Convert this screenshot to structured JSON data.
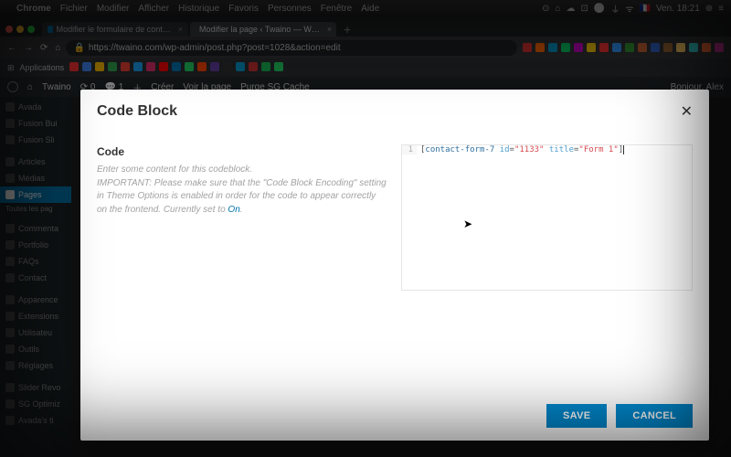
{
  "mac_menu": {
    "app": "Chrome",
    "items": [
      "Fichier",
      "Modifier",
      "Afficher",
      "Historique",
      "Favoris",
      "Personnes",
      "Fenêtre",
      "Aide"
    ],
    "clock": "Ven. 18:21"
  },
  "browser": {
    "tabs": [
      {
        "label": "Modifier le formulaire de cont…"
      },
      {
        "label": "Modifier la page ‹ Twaino — W…"
      }
    ],
    "active_tab": 1,
    "url_lock": "🔒",
    "url": "https://twaino.com/wp-admin/post.php?post=1028&action=edit",
    "bookmarks_label": "Applications",
    "ext_colors": [
      "#d33",
      "#f60",
      "#09c",
      "#0c6",
      "#c0c",
      "#fc0",
      "#f33",
      "#39f",
      "#393",
      "#c63",
      "#36c",
      "#963",
      "#fc6",
      "#3cc",
      "#e63",
      "#c39"
    ]
  },
  "wp": {
    "site": "Twaino",
    "comments_count": "1",
    "updates_count": "0",
    "create": "Créer",
    "view_page": "Voir la page",
    "purge": "Purge SG Cache",
    "greeting": "Bonjour, Alex",
    "sidebar": [
      "Avada",
      "Fusion Bui",
      "Fusion Sli",
      "",
      "Articles",
      "Médias",
      "Pages",
      "",
      "Commenta",
      "Portfolio",
      "FAQs",
      "Contact",
      "",
      "Apparence",
      "Extensions",
      "Utilisateu",
      "Outils",
      "Réglages",
      "",
      "Slider Revo",
      "SG Optimiz",
      "Avada's ti"
    ],
    "sidebar_active_index": 6,
    "sidebar_note": "Toutes les pag"
  },
  "modal": {
    "title": "Code Block",
    "section_heading": "Code",
    "desc_line1": "Enter some content for this codeblock.",
    "desc_important": "IMPORTANT: Please make sure that the \"Code Block Encoding\" setting in Theme Options is enabled in order for the code to appear correctly on the frontend. Currently set to ",
    "desc_link": "On",
    "desc_after": ".",
    "code": {
      "line_no": "1",
      "open_br": "[",
      "tag": "contact-form-7",
      "attr1_name": "id",
      "eq": "=",
      "attr1_val": "\"1133\"",
      "attr2_name": "title",
      "attr2_val": "\"Form 1\"",
      "close_br": "]"
    },
    "save": "SAVE",
    "cancel": "CANCEL",
    "close_glyph": "✕"
  },
  "bm_colors": [
    "#f33",
    "#4285f4",
    "#fbbc05",
    "#34a853",
    "#ea4335",
    "#1da1f2",
    "#e1306c",
    "#ff0000",
    "#0077b5",
    "#25d366",
    "#ff4500",
    "#6441a5",
    "#333",
    "#09c",
    "#c33",
    "#1db954",
    "#25d366"
  ]
}
